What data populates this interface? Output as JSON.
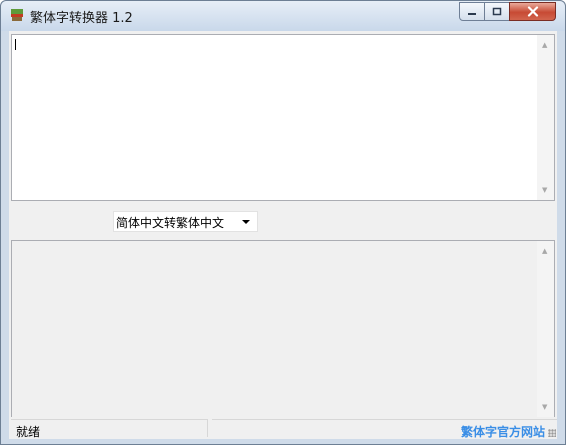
{
  "window": {
    "title": "繁体字转换器 1.2",
    "app_icon": "app-icon",
    "controls": {
      "minimize": "minimize-icon",
      "maximize": "maximize-icon",
      "close": "close-icon"
    }
  },
  "input": {
    "value": ""
  },
  "conversion": {
    "selected": "简体中文转繁体中文"
  },
  "output": {
    "value": ""
  },
  "status": {
    "text": "就绪",
    "link_label": "繁体字官方网站"
  },
  "colors": {
    "link": "#3a8ee6",
    "close_button": "#c74a34",
    "titlebar": "#cfdbe9"
  }
}
